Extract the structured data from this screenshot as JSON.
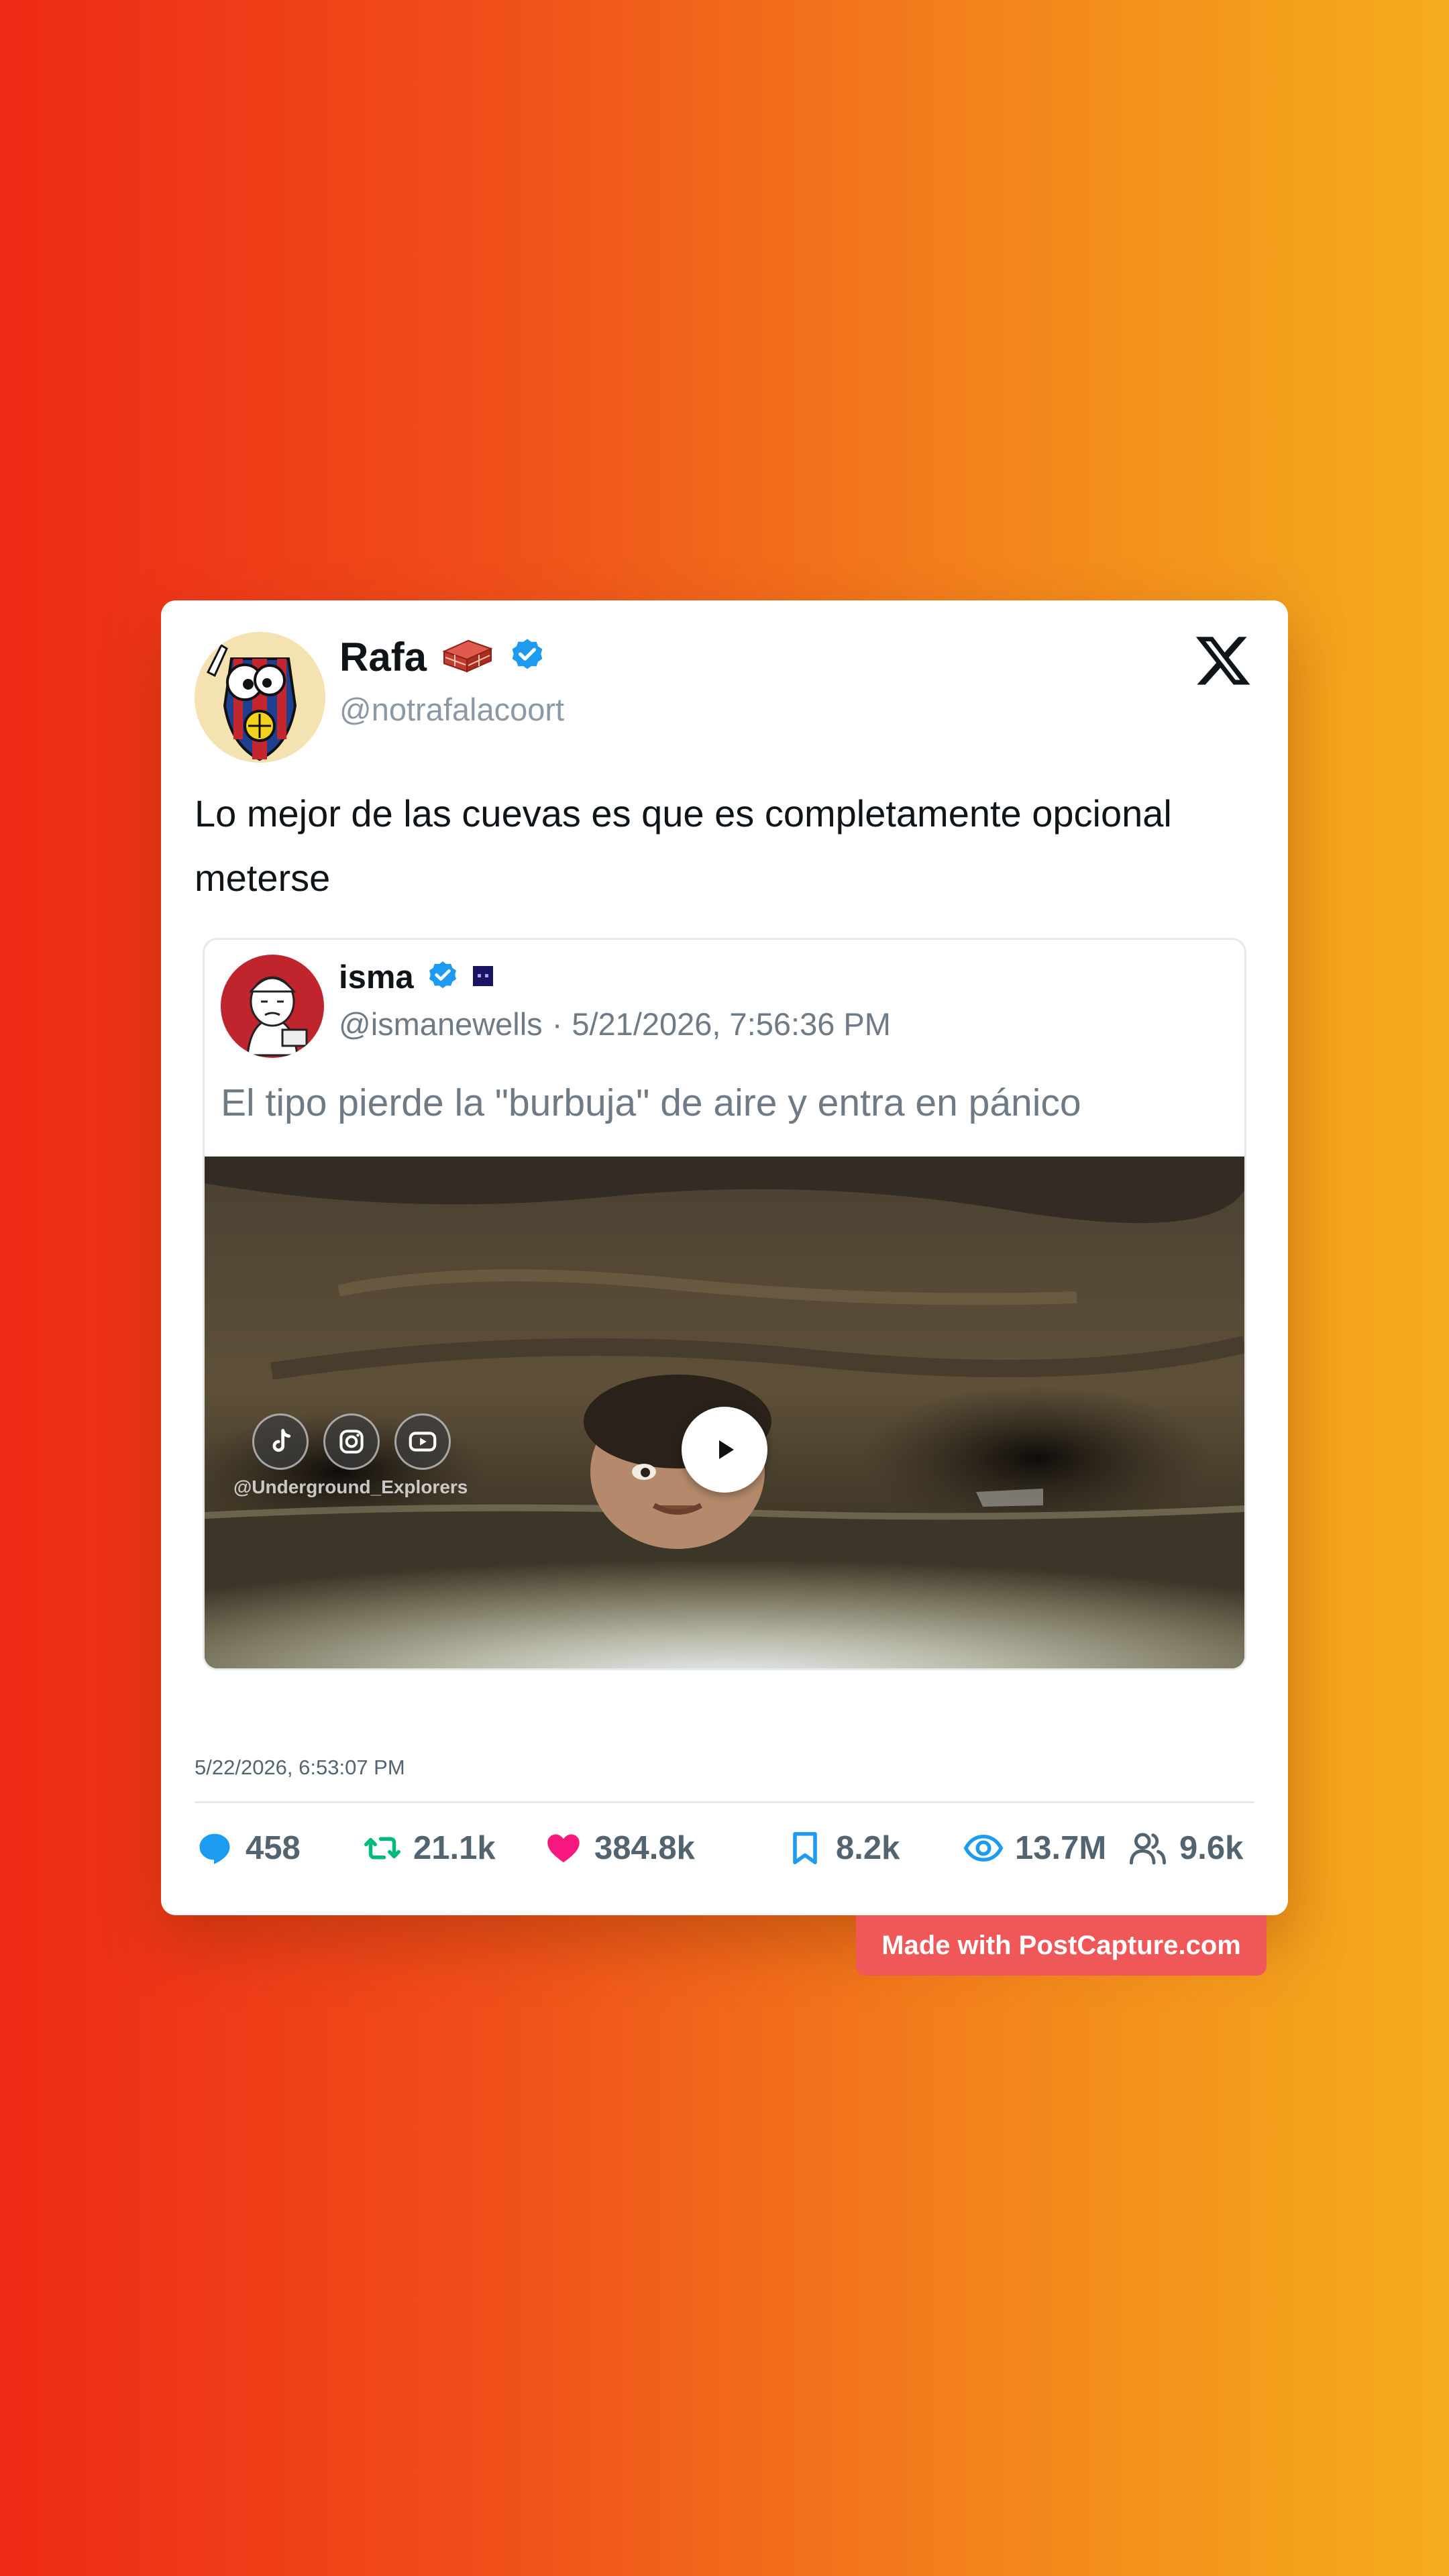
{
  "tweet": {
    "author": {
      "name": "Rafa",
      "emoji": "🧱",
      "handle": "@notrafalacoort",
      "verified": true
    },
    "text": "Lo mejor de las cuevas es que es completamente opcional meterse",
    "timestamp": "5/22/2026, 6:53:07 PM"
  },
  "quoted_tweet": {
    "author": {
      "name": "isma",
      "handle": "@ismanewells",
      "verified": true
    },
    "date_separator": "·",
    "date": "5/21/2026, 7:56:36 PM",
    "text": "El tipo pierde la \"burbuja\" de aire y entra en pánico",
    "media": {
      "type": "video",
      "watermark": "@Underground_Explorers",
      "watermark_icons": [
        "tiktok-icon",
        "instagram-icon",
        "youtube-icon"
      ]
    }
  },
  "stats": {
    "replies": "458",
    "retweets": "21.1k",
    "likes": "384.8k",
    "bookmarks": "8.2k",
    "views": "13.7M",
    "followers": "9.6k"
  },
  "badge": "Made with PostCapture.com",
  "colors": {
    "background_start": "#ee2a16",
    "background_end": "#f5ad1d",
    "verified_blue": "#1d9bf0",
    "reply_blue": "#1d9bf0",
    "retweet_green": "#00ba7c",
    "like_pink": "#f91880",
    "badge_red": "#ef5758"
  }
}
